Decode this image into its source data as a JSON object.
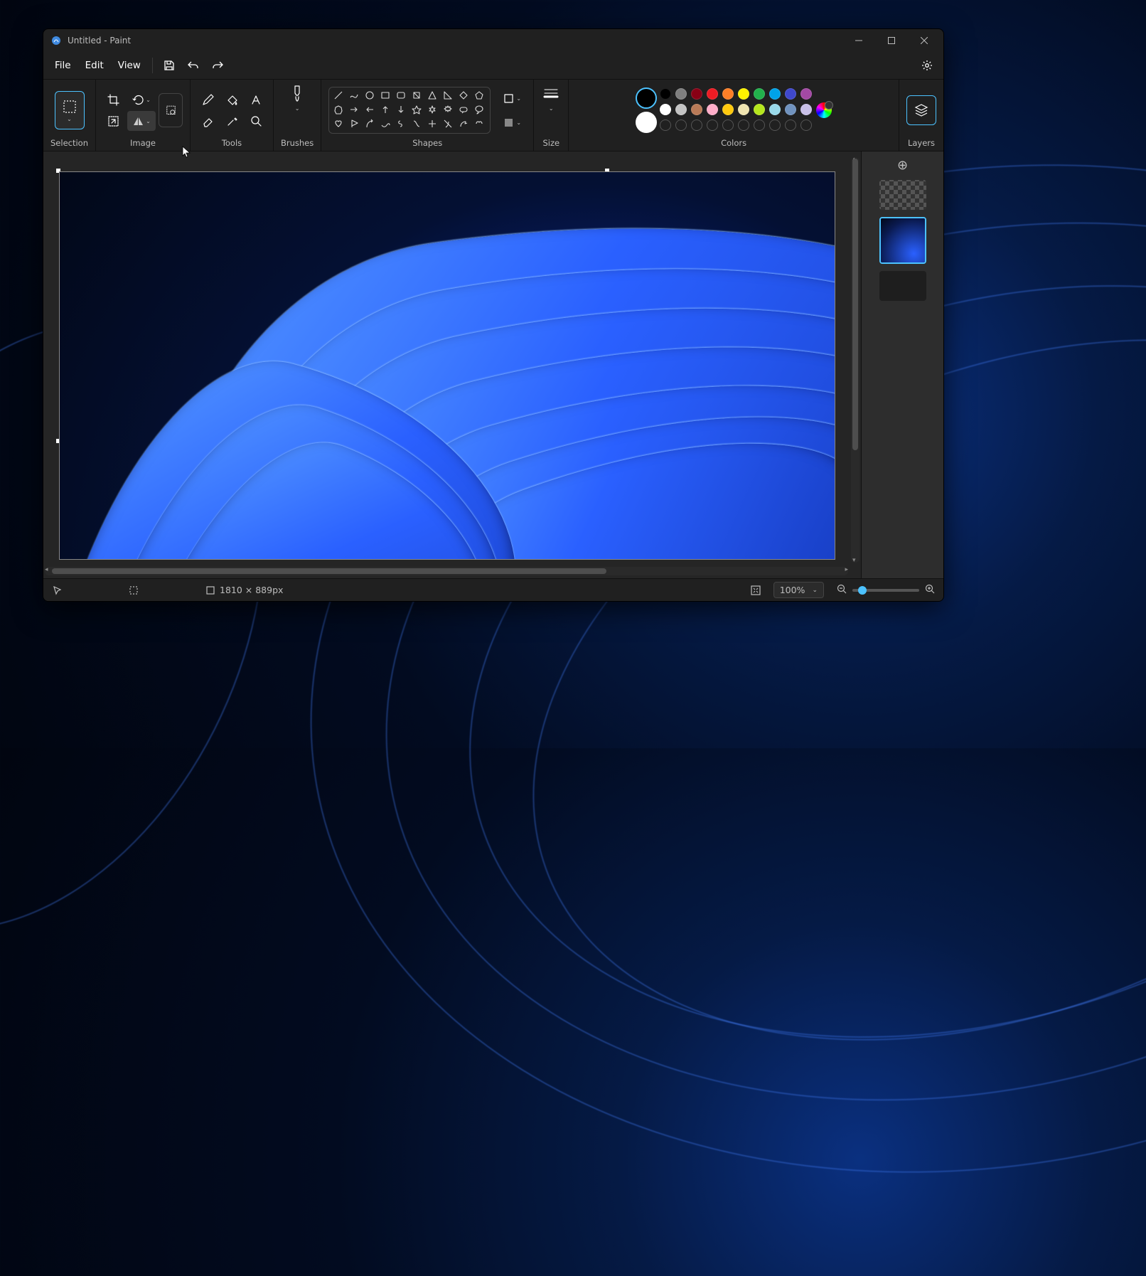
{
  "titlebar": {
    "title": "Untitled - Paint"
  },
  "menus": {
    "file": "File",
    "edit": "Edit",
    "view": "View"
  },
  "ribbon": {
    "selection": {
      "label": "Selection"
    },
    "image": {
      "label": "Image"
    },
    "tools": {
      "label": "Tools"
    },
    "brushes": {
      "label": "Brushes"
    },
    "shapes": {
      "label": "Shapes"
    },
    "size": {
      "label": "Size"
    },
    "colors": {
      "label": "Colors"
    },
    "layers": {
      "label": "Layers"
    }
  },
  "colors": {
    "primary": "#000000",
    "secondary": "#ffffff",
    "row1": [
      "#000000",
      "#7f7f7f",
      "#880015",
      "#ed1c24",
      "#ff7f27",
      "#fff200",
      "#22b14c",
      "#00a2e8",
      "#3f48cc",
      "#a349a4"
    ],
    "row2": [
      "#ffffff",
      "#c3c3c3",
      "#b97a57",
      "#ffaec9",
      "#ffc90e",
      "#efe4b0",
      "#b5e61d",
      "#99d9ea",
      "#7092be",
      "#c8bfe7"
    ],
    "row3_empty_count": 10
  },
  "statusbar": {
    "canvas_size": "1810 × 889px",
    "zoom": "100%"
  }
}
